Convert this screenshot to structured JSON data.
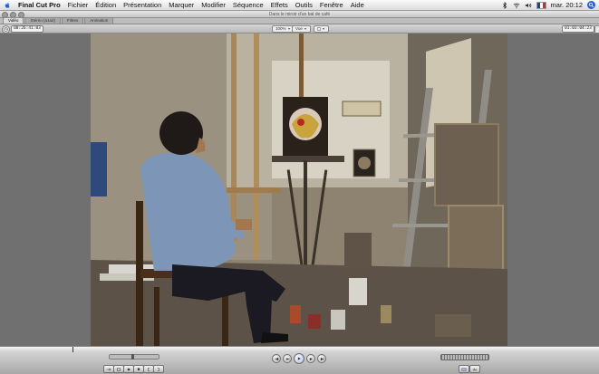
{
  "menubar": {
    "app_name": "Final Cut Pro",
    "items": [
      "Fichier",
      "Édition",
      "Présentation",
      "Marquer",
      "Modifier",
      "Séquence",
      "Effets",
      "Outils",
      "Fenêtre",
      "Aide"
    ],
    "clock": "mar. 20:12"
  },
  "window": {
    "title": "Dans le miroir d'un bal de café"
  },
  "tabs": [
    "Vidéo",
    "Stéréo (a1a2)",
    "Filtres",
    "Animation"
  ],
  "viewer": {
    "timecode_duration": "00:26:41:03",
    "timecode_current": "01:03:04:23",
    "zoom_label": "100%",
    "view_label": "Vue"
  },
  "colors": {
    "brand_blue": "#2b5fd8",
    "flag_blue": "#1f3f9f",
    "flag_white": "#ffffff",
    "flag_red": "#d02a2a"
  }
}
